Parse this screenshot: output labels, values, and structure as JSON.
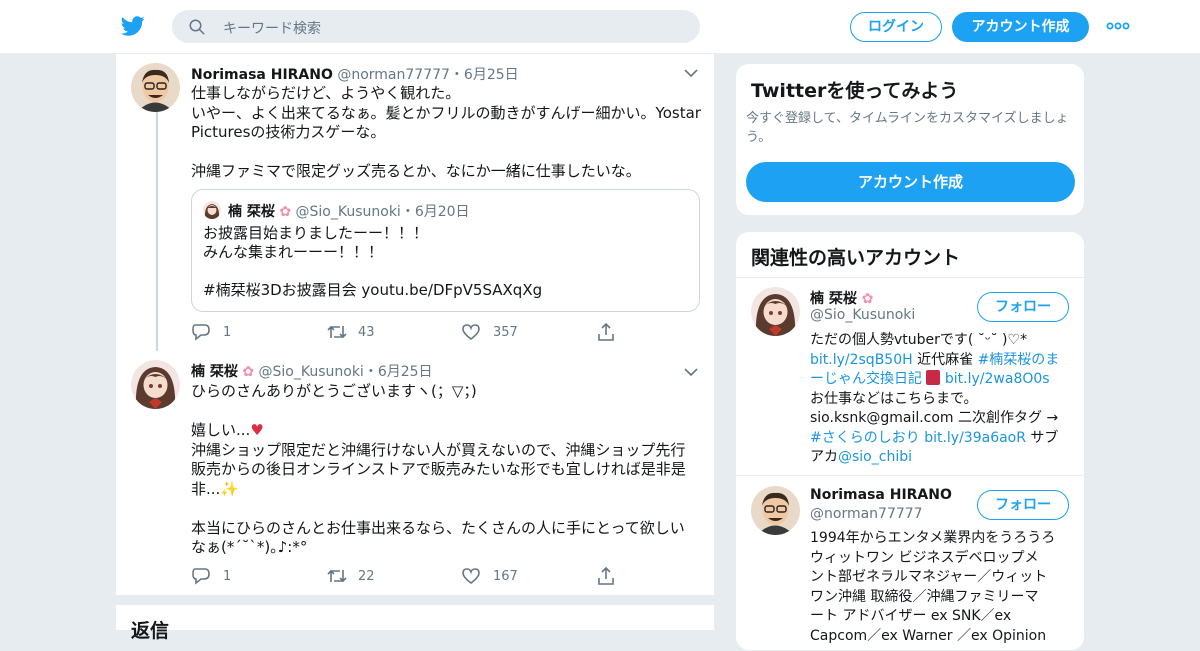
{
  "topbar": {
    "search_placeholder": "キーワード検索",
    "login_label": "ログイン",
    "signup_label": "アカウント作成",
    "brand_color": "#1da1f2"
  },
  "tweets": [
    {
      "name": "Norimasa HIRANO",
      "handle": "@norman77777",
      "separator": "・",
      "date": "6月25日",
      "lines": [
        "仕事しながらだけど、ようやく観れた。",
        "いやー、よく出来てるなぁ。髪とかフリルの動きがすんげー細かい。Yostar",
        "Picturesの技術力スゲーな。",
        "",
        "沖縄ファミマで限定グッズ売るとか、なにか一緒に仕事したいな。"
      ],
      "quote": {
        "name": "楠 栞桜",
        "handle": "@Sio_Kusunoki",
        "separator": "・",
        "date": "6月20日",
        "lines": [
          "お披露目始まりましたーー！！！",
          "みんな集まれーーー！！！",
          "",
          "#楠栞桜3Dお披露目会 youtu.be/DFpV5SAXqXg"
        ]
      },
      "replies": "1",
      "retweets": "43",
      "likes": "357"
    },
    {
      "name": "楠 栞桜",
      "handle": "@Sio_Kusunoki",
      "separator": "・",
      "date": "6月25日",
      "lines": [
        "ひらのさんありがとうございますヽ(；▽；)",
        "",
        "嬉しい...",
        "沖縄ショップ限定だと沖縄行けない人が買えないので、沖縄ショップ先行",
        "販売からの後日オンラインストアで販売みたいな形でも宜しければ是非是",
        "非...",
        "",
        "本当にひらのさんとお仕事出来るなら、たくさんの人に手にとって欲しい",
        "なぁ(*´˘`*)｡♪:*°"
      ],
      "replies": "1",
      "retweets": "22",
      "likes": "167"
    }
  ],
  "reply_section_title": "返信",
  "sidebar": {
    "try_card": {
      "title": "Twitterを使ってみよう",
      "subtitle": "今すぐ登録して、タイムラインをカスタマイズしましょう。",
      "cta": "アカウント作成"
    },
    "related": {
      "title": "関連性の高いアカウント",
      "follow_label": "フォロー",
      "accounts": [
        {
          "name": "楠 栞桜",
          "handle": "@Sio_Kusunoki",
          "bio": {
            "l1": "ただの個人勢vtuberです( ˘ᵕ˘ )♡*",
            "l2_link1": "bit.ly/2sqB50H",
            "l2_text": " 近代麻雀 ",
            "l2_link2": "#楠栞桜のま",
            "l3_link": "ーじゃん交換日記",
            "l3_link2": "bit.ly/2wa8O0s",
            "l4": "お仕事などはこちらまで。",
            "l5": "sio.ksnk@gmail.com 二次創作タグ →",
            "l6_link1": "#さくらのしおり",
            "l6_link2": "bit.ly/39a6aoR",
            "l6_text": " サブ",
            "l7_text": "アカ",
            "l7_link": "@sio_chibi"
          }
        },
        {
          "name": "Norimasa HIRANO",
          "handle": "@norman77777",
          "bio_lines": [
            "1994年からエンタメ業界内をうろうろ",
            "ウィットワン ビジネスデベロップメ",
            "ント部ゼネラルマネジャー／ウィット",
            "ワン沖縄 取締役／沖縄ファミリーマ",
            "ート アドバイザー ex SNK／ex",
            "Capcom／ex Warner ／ex Opinion"
          ]
        }
      ]
    }
  }
}
